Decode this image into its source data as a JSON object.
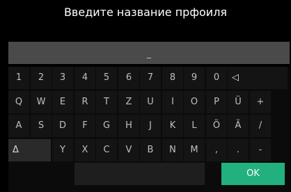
{
  "title": "Введите название прфоиля",
  "input": {
    "value": "_"
  },
  "keyboard": {
    "row1": [
      "1",
      "2",
      "3",
      "4",
      "5",
      "6",
      "7",
      "8",
      "9",
      "0"
    ],
    "backspace": "◁",
    "row2": [
      "Q",
      "W",
      "E",
      "R",
      "T",
      "Z",
      "U",
      "I",
      "O",
      "P",
      "Ü",
      "+"
    ],
    "row3": [
      "A",
      "S",
      "D",
      "F",
      "G",
      "H",
      "J",
      "K",
      "L",
      "Ö",
      "Ä",
      "/"
    ],
    "shift": "Δ",
    "row4": [
      "Y",
      "X",
      "C",
      "V",
      "B",
      "N",
      "M",
      ",",
      ".",
      "-"
    ],
    "space": "",
    "ok": "OK"
  }
}
